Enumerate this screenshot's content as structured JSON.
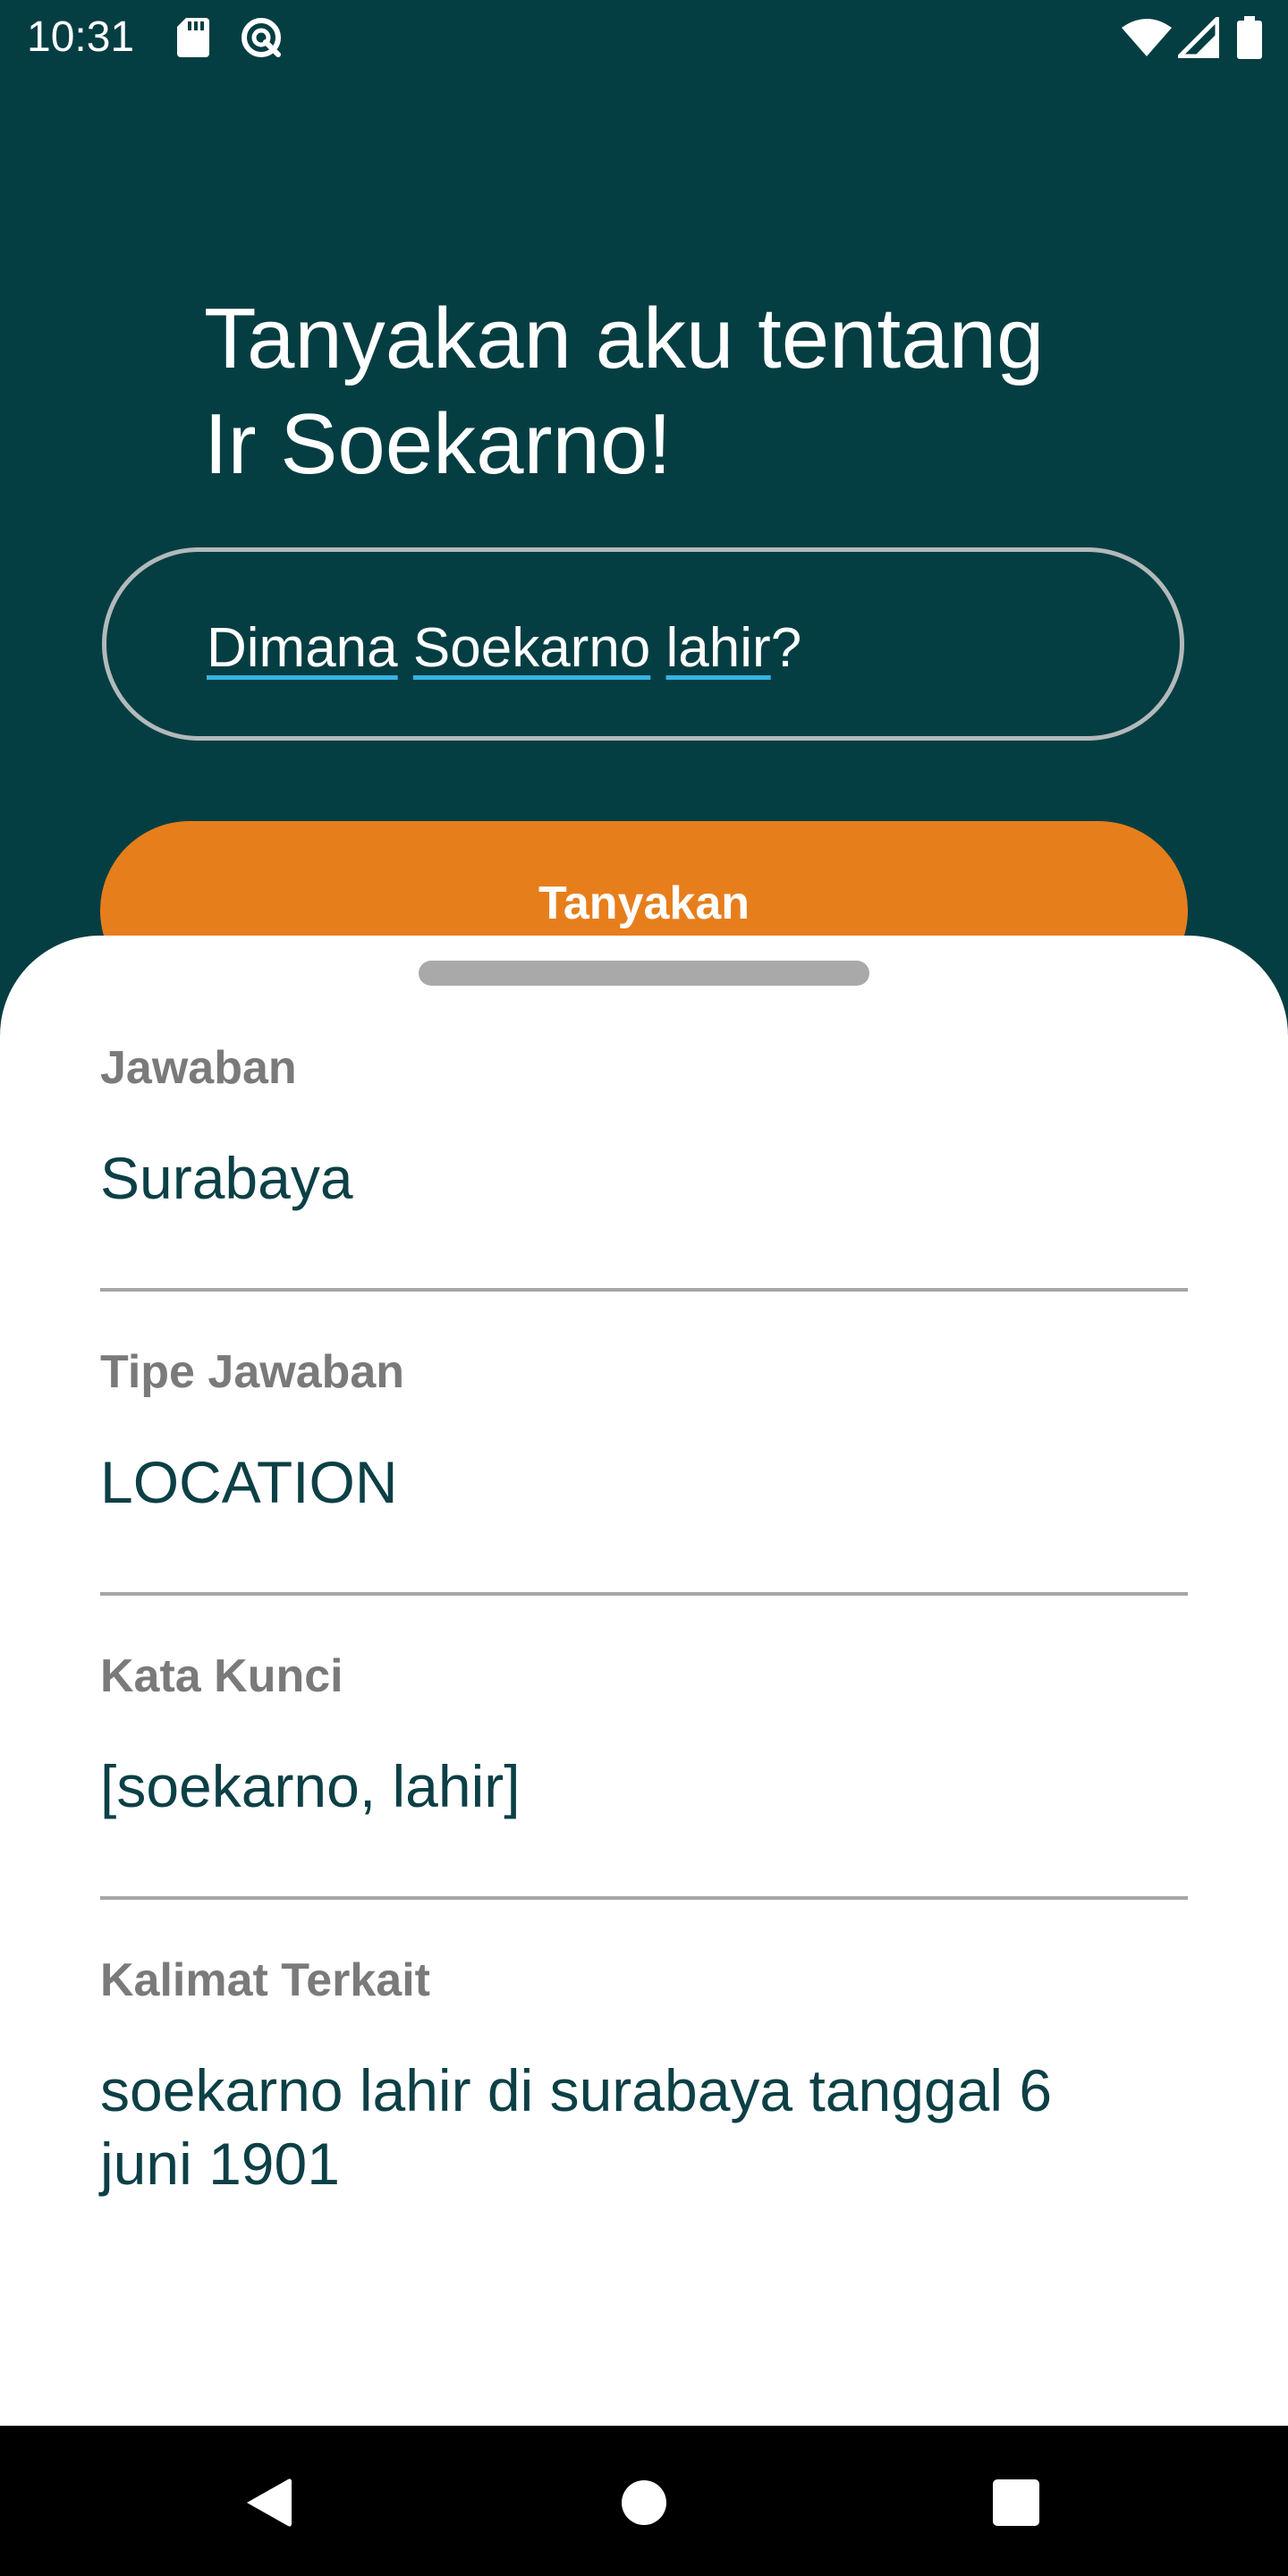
{
  "status_bar": {
    "time": "10:31",
    "icons": [
      "sd-card-icon",
      "sync-off-icon",
      "wifi-icon",
      "cell-signal-icon",
      "battery-icon"
    ]
  },
  "header": {
    "title": "Tanyakan aku tentang\nIr Soekarno!"
  },
  "question": {
    "words": [
      "Dimana",
      "Soekarno",
      "lahir"
    ],
    "suffix": "?"
  },
  "ask_button": {
    "label": "Tanyakan"
  },
  "results": {
    "answer_label": "Jawaban",
    "answer_value": "Surabaya",
    "type_label": "Tipe Jawaban",
    "type_value": "LOCATION",
    "keywords_label": "Kata Kunci",
    "keywords_value": "[soekarno, lahir]",
    "sentence_label": "Kalimat Terkait",
    "sentence_value": "soekarno lahir di surabaya tanggal 6 juni 1901"
  },
  "navigation": {
    "buttons": [
      "back-icon",
      "home-icon",
      "recents-icon"
    ]
  },
  "colors": {
    "background": "#053e42",
    "accent": "#e77e1c",
    "value_text": "#0c4046",
    "label_text": "#7a7a7a",
    "spell_underline": "#35b3e6"
  }
}
